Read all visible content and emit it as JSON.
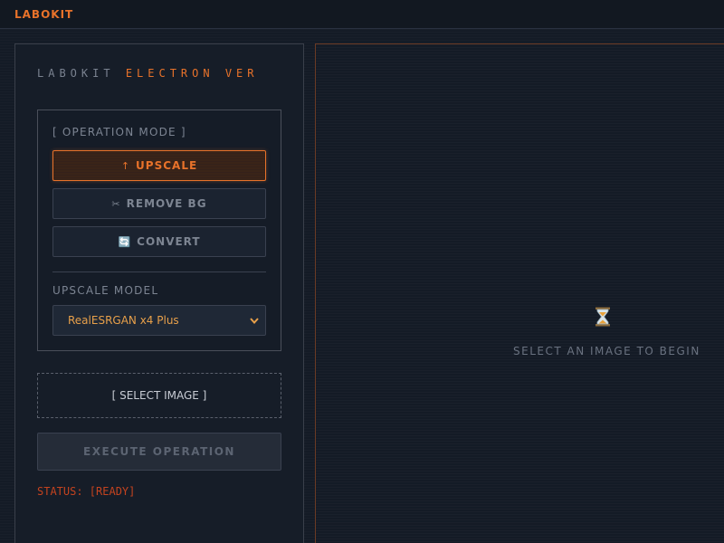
{
  "app": {
    "brand": "LABOKIT",
    "title_part1": "LABOKIT",
    "title_part2": "ELECTRON VER"
  },
  "mode": {
    "section_label": "[ OPERATION MODE ]",
    "buttons": [
      {
        "label": "UPSCALE",
        "icon": "↑",
        "icon_name": "arrow-up-icon",
        "active": true
      },
      {
        "label": "REMOVE BG",
        "icon": "✂",
        "icon_name": "scissors-icon",
        "active": false
      },
      {
        "label": "CONVERT",
        "icon": "🔄",
        "icon_name": "refresh-icon",
        "active": false
      }
    ]
  },
  "model": {
    "label": "UPSCALE MODEL",
    "selected": "RealESRGAN x4 Plus"
  },
  "actions": {
    "select_image": "[ SELECT IMAGE ]",
    "execute": "EXECUTE OPERATION"
  },
  "status": {
    "text": "STATUS: [READY]"
  },
  "preview": {
    "empty_message": "SELECT AN IMAGE TO BEGIN",
    "icon_name": "hourglass-icon"
  },
  "colors": {
    "accent": "#e8722a",
    "status": "#c4431f",
    "background": "#141b26"
  }
}
